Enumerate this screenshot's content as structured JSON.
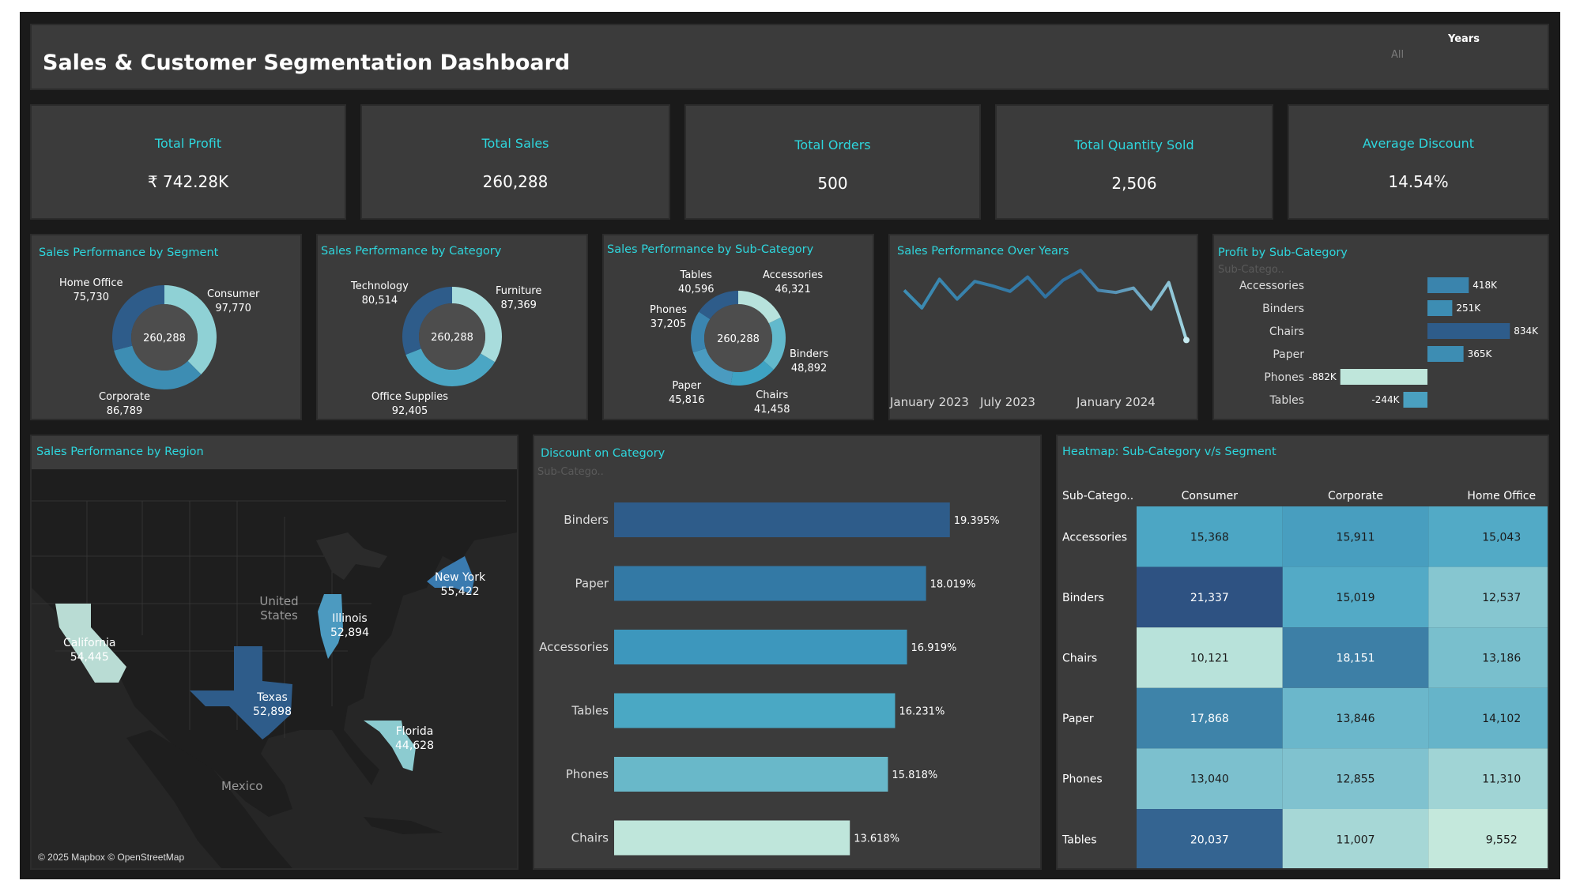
{
  "header": {
    "title": "Sales & Customer Segmentation Dashboard",
    "filter_label": "Years",
    "filter_value": "All"
  },
  "kpis": [
    {
      "label": "Total Profit",
      "value": "₹ 742.28K"
    },
    {
      "label": "Total Sales",
      "value": "260,288"
    },
    {
      "label": "Total Orders",
      "value": "500"
    },
    {
      "label": "Total Quantity Sold",
      "value": "2,506"
    },
    {
      "label": "Average Discount",
      "value": "14.54%"
    }
  ],
  "segment": {
    "title": "Sales Performance by Segment",
    "center": "260,288",
    "slices": [
      {
        "name": "Consumer",
        "value": "97,770"
      },
      {
        "name": "Corporate",
        "value": "86,789"
      },
      {
        "name": "Home Office",
        "value": "75,730"
      }
    ]
  },
  "category": {
    "title": "Sales Performance by Category",
    "center": "260,288",
    "slices": [
      {
        "name": "Furniture",
        "value": "87,369"
      },
      {
        "name": "Office Supplies",
        "value": "92,405"
      },
      {
        "name": "Technology",
        "value": "80,514"
      }
    ]
  },
  "subcategory": {
    "title": "Sales Performance by Sub-Category",
    "center": "260,288",
    "slices": [
      {
        "name": "Accessories",
        "value": "46,321"
      },
      {
        "name": "Binders",
        "value": "48,892"
      },
      {
        "name": "Chairs",
        "value": "41,458"
      },
      {
        "name": "Paper",
        "value": "45,816"
      },
      {
        "name": "Phones",
        "value": "37,205"
      },
      {
        "name": "Tables",
        "value": "40,596"
      }
    ]
  },
  "years": {
    "title": "Sales Performance Over Years",
    "ticks": [
      "January 2023",
      "July 2023",
      "January 2024"
    ]
  },
  "profit": {
    "title": "Profit by Sub-Category",
    "header": "Sub-Catego..",
    "rows": [
      {
        "name": "Accessories",
        "label": "418K"
      },
      {
        "name": "Binders",
        "label": "251K"
      },
      {
        "name": "Chairs",
        "label": "834K"
      },
      {
        "name": "Paper",
        "label": "365K"
      },
      {
        "name": "Phones",
        "label": "-882K"
      },
      {
        "name": "Tables",
        "label": "-244K"
      }
    ]
  },
  "region": {
    "title": "Sales Performance by Region",
    "country_label": "United States",
    "mexico_label": "Mexico",
    "attribution": "© 2025 Mapbox © OpenStreetMap",
    "states": [
      {
        "name": "California",
        "value": "54,445"
      },
      {
        "name": "Illinois",
        "value": "52,894"
      },
      {
        "name": "New York",
        "value": "55,422"
      },
      {
        "name": "Texas",
        "value": "52,898"
      },
      {
        "name": "Florida",
        "value": "44,628"
      }
    ]
  },
  "discount": {
    "title": "Discount on Category",
    "header": "Sub-Catego..",
    "rows": [
      {
        "name": "Binders",
        "label": "19.395%"
      },
      {
        "name": "Paper",
        "label": "18.019%"
      },
      {
        "name": "Accessories",
        "label": "16.919%"
      },
      {
        "name": "Tables",
        "label": "16.231%"
      },
      {
        "name": "Phones",
        "label": "15.818%"
      },
      {
        "name": "Chairs",
        "label": "13.618%"
      }
    ]
  },
  "heatmap": {
    "title": "Heatmap: Sub-Category v/s Segment",
    "corner": "Sub-Catego..",
    "columns": [
      "Consumer",
      "Corporate",
      "Home Office"
    ],
    "rows": [
      {
        "name": "Accessories",
        "cells": [
          "15,368",
          "15,911",
          "15,043"
        ]
      },
      {
        "name": "Binders",
        "cells": [
          "21,337",
          "15,019",
          "12,537"
        ]
      },
      {
        "name": "Chairs",
        "cells": [
          "10,121",
          "18,151",
          "13,186"
        ]
      },
      {
        "name": "Paper",
        "cells": [
          "17,868",
          "13,846",
          "14,102"
        ]
      },
      {
        "name": "Phones",
        "cells": [
          "13,040",
          "12,855",
          "11,310"
        ]
      },
      {
        "name": "Tables",
        "cells": [
          "20,037",
          "11,007",
          "9,552"
        ]
      }
    ]
  },
  "colors": {
    "accent": "#2ed6dd",
    "panel": "#3b3b3b",
    "background": "#1a1a1a"
  },
  "chart_data": [
    {
      "type": "pie",
      "title": "Sales Performance by Segment",
      "categories": [
        "Consumer",
        "Corporate",
        "Home Office"
      ],
      "values": [
        97770,
        86789,
        75730
      ],
      "colors": [
        "#8fd1d5",
        "#3d8db3",
        "#2e5c8a"
      ]
    },
    {
      "type": "pie",
      "title": "Sales Performance by Category",
      "categories": [
        "Furniture",
        "Office Supplies",
        "Technology"
      ],
      "values": [
        87369,
        92405,
        80514
      ],
      "colors": [
        "#a8dcdc",
        "#4ba6c4",
        "#2e5c8a"
      ]
    },
    {
      "type": "pie",
      "title": "Sales Performance by Sub-Category",
      "categories": [
        "Accessories",
        "Binders",
        "Chairs",
        "Paper",
        "Phones",
        "Tables"
      ],
      "values": [
        46321,
        48892,
        41458,
        45816,
        37205,
        40596
      ],
      "colors": [
        "#b7e2dc",
        "#62b9cc",
        "#3ea3c3",
        "#4a9bc0",
        "#3b85b0",
        "#2e5c8a"
      ]
    },
    {
      "type": "line",
      "title": "Sales Performance Over Years",
      "x": [
        "2023-01",
        "2023-02",
        "2023-03",
        "2023-04",
        "2023-05",
        "2023-06",
        "2023-07",
        "2023-08",
        "2023-09",
        "2023-10",
        "2023-11",
        "2023-12",
        "2024-01",
        "2024-02",
        "2024-03",
        "2024-04",
        "2024-05",
        "2024-06"
      ],
      "y": [
        11400,
        9800,
        12400,
        10600,
        12200,
        11800,
        11300,
        12600,
        10800,
        12300,
        13200,
        11400,
        11200,
        11600,
        9700,
        12100,
        6900,
        null
      ],
      "ticks": [
        "January 2023",
        "July 2023",
        "January 2024"
      ]
    },
    {
      "type": "bar",
      "title": "Profit by Sub-Category",
      "categories": [
        "Accessories",
        "Binders",
        "Chairs",
        "Paper",
        "Phones",
        "Tables"
      ],
      "values": [
        418,
        251,
        834,
        365,
        -882,
        -244
      ],
      "unit": "K",
      "colors": [
        "#3a84ad",
        "#3d8db3",
        "#2e5c8a",
        "#3d8db3",
        "#bfe6db",
        "#4aa0c0"
      ]
    },
    {
      "type": "bar",
      "title": "Discount on Category",
      "categories": [
        "Binders",
        "Paper",
        "Accessories",
        "Tables",
        "Phones",
        "Chairs"
      ],
      "values": [
        19.395,
        18.019,
        16.919,
        16.231,
        15.818,
        13.618
      ],
      "unit": "%",
      "xlim": [
        0,
        20
      ],
      "colors": [
        "#2e5c8a",
        "#3379a5",
        "#3d97bd",
        "#4aa8c4",
        "#69b8c9",
        "#bfe6db"
      ]
    },
    {
      "type": "heatmap",
      "title": "Heatmap: Sub-Category v/s Segment",
      "x": [
        "Consumer",
        "Corporate",
        "Home Office"
      ],
      "y": [
        "Accessories",
        "Binders",
        "Chairs",
        "Paper",
        "Phones",
        "Tables"
      ],
      "values": [
        [
          15368,
          15911,
          15043
        ],
        [
          21337,
          15019,
          12537
        ],
        [
          10121,
          18151,
          13186
        ],
        [
          17868,
          13846,
          14102
        ],
        [
          13040,
          12855,
          11310
        ],
        [
          20037,
          11007,
          9552
        ]
      ]
    }
  ]
}
